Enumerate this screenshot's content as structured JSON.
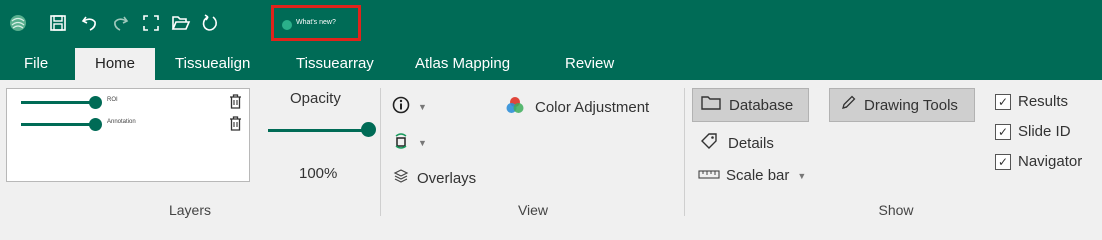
{
  "titlebar": {
    "icons": [
      "app-logo-icon",
      "save-icon",
      "undo-icon",
      "redo-icon",
      "fullscreen-icon",
      "open-folder-icon",
      "refresh-icon"
    ],
    "whats_new_label": "What's new?"
  },
  "tabs": [
    {
      "label": "File"
    },
    {
      "label": "Home",
      "active": true
    },
    {
      "label": "Tissuealign"
    },
    {
      "label": "Tissuearray"
    },
    {
      "label": "Atlas Mapping"
    },
    {
      "label": "Review"
    }
  ],
  "layers": {
    "group_label": "Layers",
    "items": [
      {
        "name": "ROI"
      },
      {
        "name": "Annotation"
      }
    ],
    "opacity_label": "Opacity",
    "opacity_value": "100%",
    "opacity_level": 1.0
  },
  "view": {
    "group_label": "View",
    "color_adjustment_label": "Color Adjustment",
    "overlays_label": "Overlays"
  },
  "show": {
    "group_label": "Show",
    "database_label": "Database",
    "drawing_tools_label": "Drawing Tools",
    "details_label": "Details",
    "scale_bar_label": "Scale bar",
    "checkboxes": [
      {
        "label": "Results",
        "checked": true
      },
      {
        "label": "Slide ID",
        "checked": true
      },
      {
        "label": "Navigator",
        "checked": true
      }
    ]
  },
  "colors": {
    "brand": "#006b56",
    "highlight_border": "#e0231b",
    "ribbon_bg": "#f0f0f0"
  }
}
